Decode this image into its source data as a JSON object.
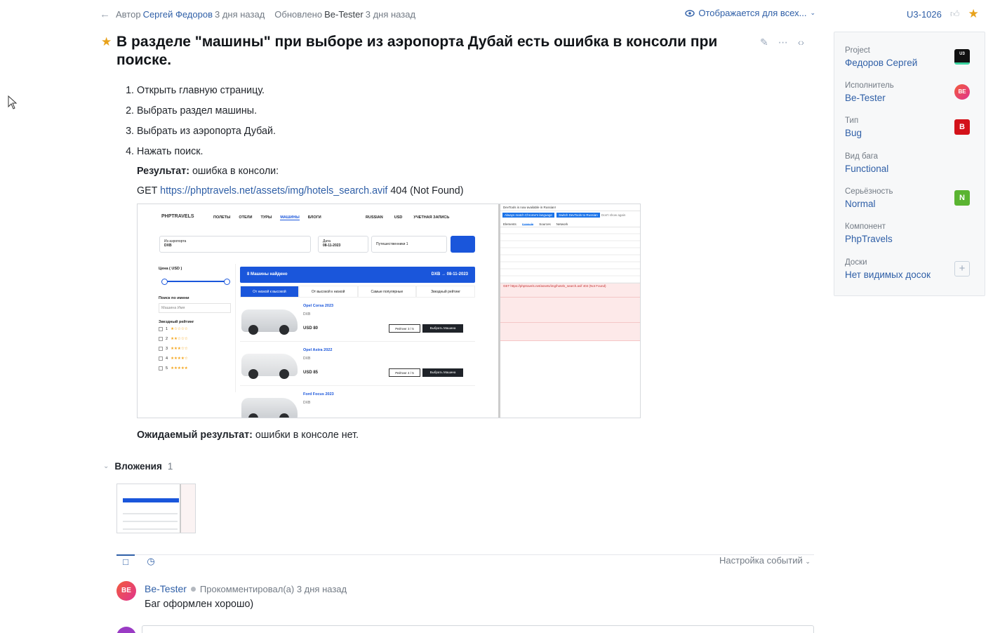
{
  "header": {
    "author_label": "Автор",
    "author_name": "Сергей Федоров",
    "author_time": "3 дня назад",
    "updated_label": "Обновлено",
    "updated_by": "Be-Tester",
    "updated_time": "3 дня назад",
    "visibility": "Отображается для всех...",
    "issue_id": "U3-1026"
  },
  "issue": {
    "title": "В разделе \"машины\" при выборе из аэропорта Дубай есть ошибка в консоли при поиске.",
    "steps": [
      "Открыть главную страницу.",
      "Выбрать раздел машины.",
      "Выбрать из аэропорта Дубай.",
      "Нажать поиск."
    ],
    "result_label": "Результат:",
    "result_text": "ошибка в консоли:",
    "get_prefix": "GET",
    "get_url": "https://phptravels.net/assets/img/hotels_search.avif",
    "get_status": "404 (Not Found)",
    "expected_label": "Ожидаемый результат:",
    "expected_text": "ошибки в консоле нет."
  },
  "screenshot": {
    "logo": "PHPTRAVELS",
    "nav": [
      "ПОЛЕТЫ",
      "ОТЕЛИ",
      "ТУРЫ",
      "МАШИНЫ",
      "БЛОГИ"
    ],
    "nav_right": [
      "RUSSIAN",
      "USD",
      "УЧЕТНАЯ ЗАПИСЬ"
    ],
    "from_label": "Из аэропорта",
    "from_value": "DXB",
    "date_label": "Дата",
    "date_value": "08-11-2023",
    "travelers": "Путешественники 1",
    "price_label": "Цена ( USD )",
    "search_name_label": "Поиск по имени",
    "search_name_placeholder": "Машина Имя",
    "rating_label": "Звездный рейтинг",
    "ratings": [
      "1",
      "2",
      "3",
      "4",
      "5"
    ],
    "results_title": "8 Машины найдено",
    "results_route": "DXB → 08-11-2023",
    "tabs": [
      "От низкой к высокой",
      "От высокой к низкой",
      "Самые популярные",
      "Звездный рейтинг"
    ],
    "cars": [
      {
        "name": "Opel Corsa 2023",
        "code": "DXB",
        "price": "USD 80",
        "rating": "Рейтинг 3 / 5",
        "select": "Выбрать Машина"
      },
      {
        "name": "Opel Astra 2022",
        "code": "DXB",
        "price": "USD 85",
        "rating": "Рейтинг 4 / 5",
        "select": "Выбрать Машина"
      },
      {
        "name": "Ford Focus 2023",
        "code": "DXB",
        "price": "",
        "rating": "",
        "select": ""
      }
    ],
    "devtools_notice": "DevTools is now available in Russian!",
    "devtools_btn1": "Always match Chrome's language",
    "devtools_btn2": "Switch DevTools to Russian",
    "devtools_btn3": "Don't show again",
    "devtools_tabs": [
      "Elements",
      "Console",
      "Sources",
      "Network"
    ],
    "devtools_error": "GET https://phptravels.net/assets/img/hotels_search.avif 404 (Not Found)"
  },
  "attachments": {
    "label": "Вложения",
    "count": "1"
  },
  "activity": {
    "settings": "Настройка событий",
    "comment_author": "Be-Tester",
    "comment_meta": "Прокомментировал(а) 3 дня назад",
    "comment_text": "Баг оформлен хорошо)",
    "avatar_initials": "BE"
  },
  "panel": {
    "fields": [
      {
        "key": "Project",
        "value": "Федоров Сергей",
        "badge": "U3"
      },
      {
        "key": "Исполнитель",
        "value": "Be-Tester",
        "badge": "BE"
      },
      {
        "key": "Тип",
        "value": "Bug",
        "badge": "B"
      },
      {
        "key": "Вид бага",
        "value": "Functional",
        "badge": ""
      },
      {
        "key": "Серьёзность",
        "value": "Normal",
        "badge": "N"
      },
      {
        "key": "Компонент",
        "value": "PhpTravels",
        "badge": ""
      },
      {
        "key": "Доски",
        "value": "Нет видимых досок",
        "badge": "+"
      }
    ]
  },
  "colors": {
    "accent": "#2f5fa7",
    "star": "#e8a21b",
    "bug": "#d3121a",
    "normal": "#5ab431"
  }
}
